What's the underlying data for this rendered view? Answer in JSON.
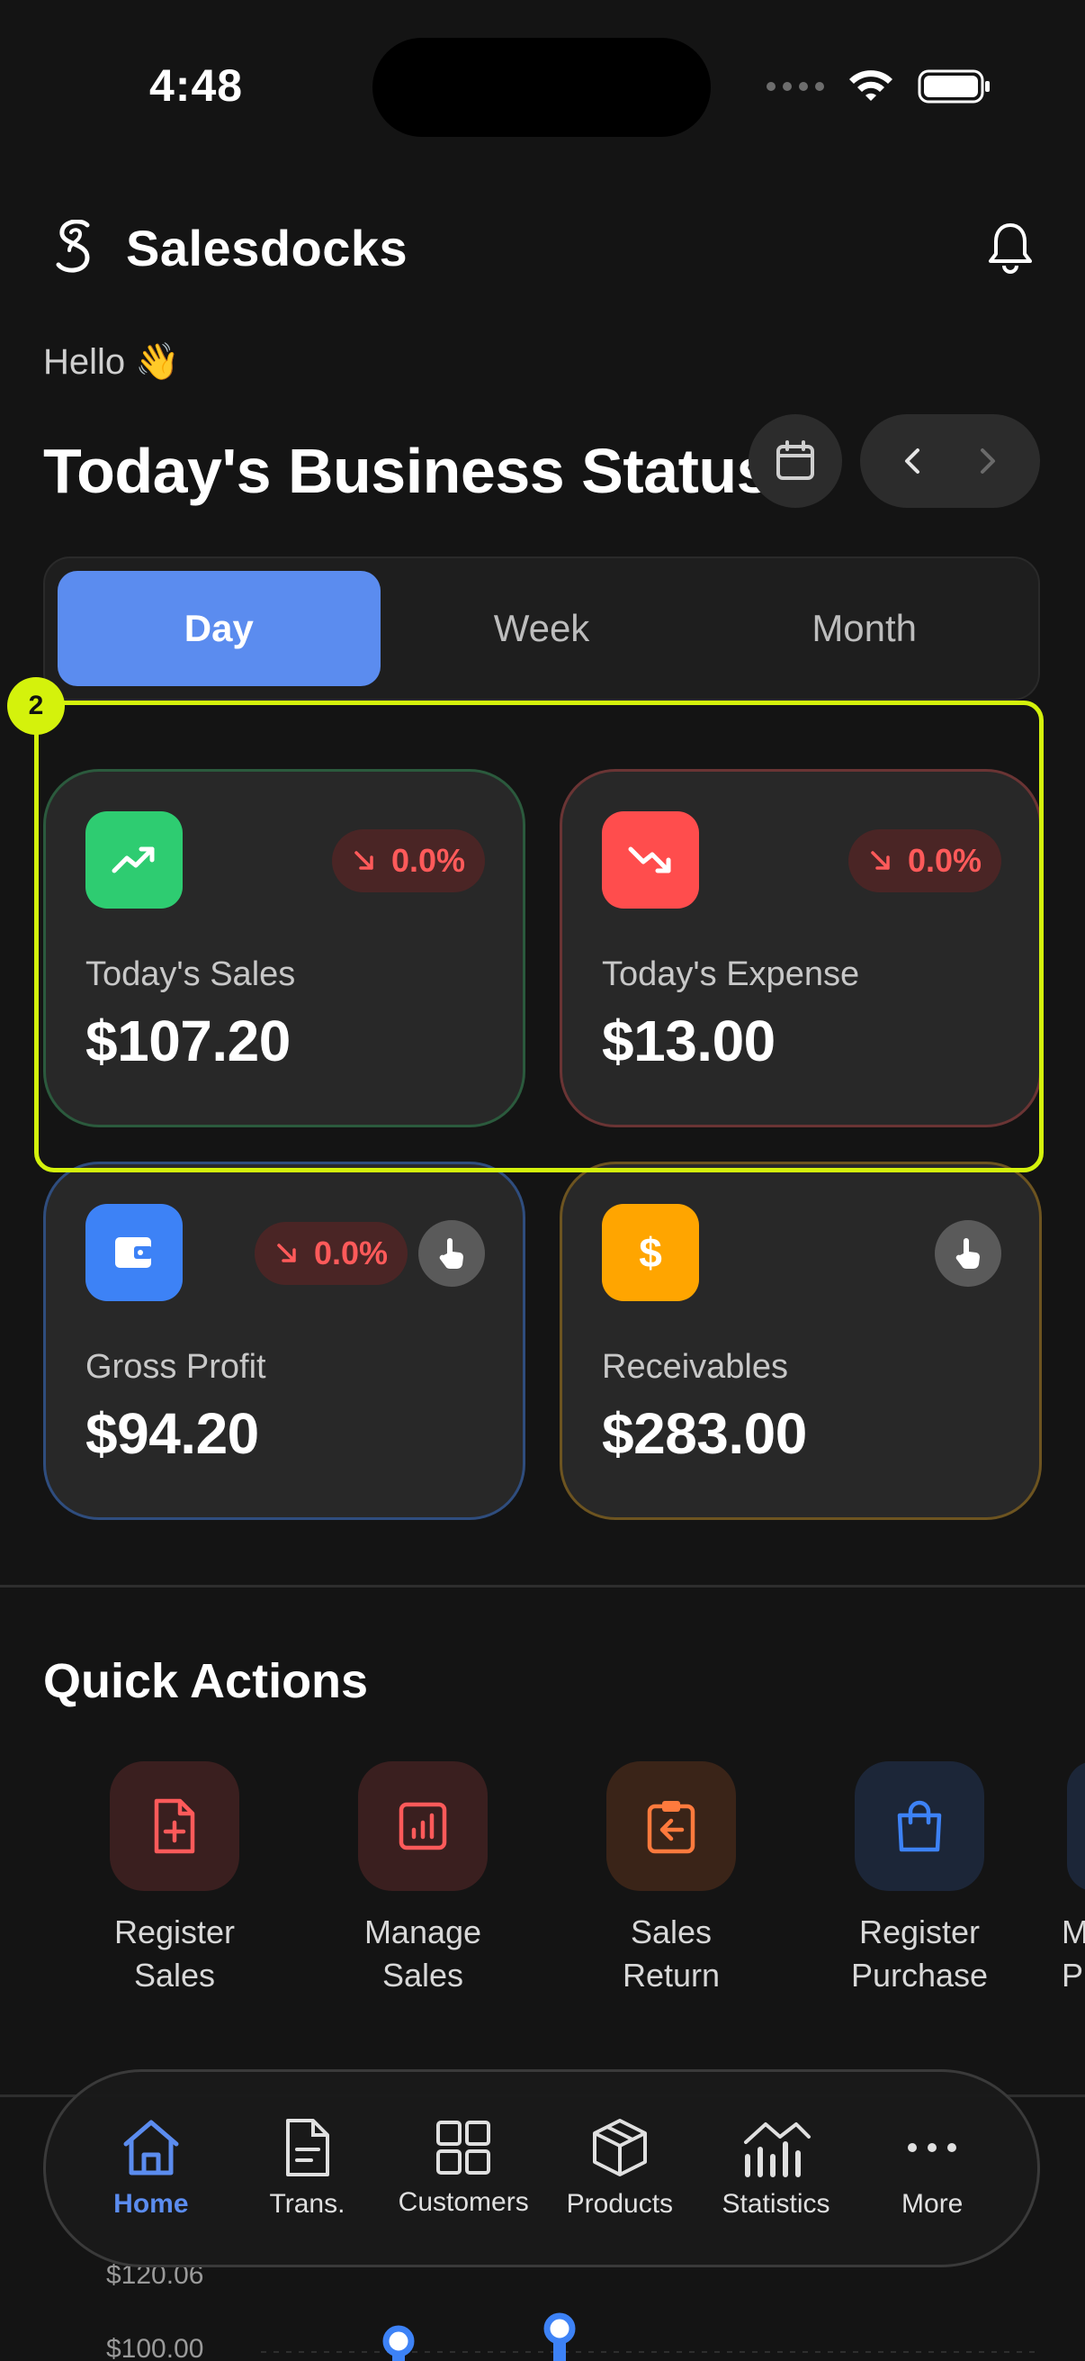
{
  "status_bar": {
    "time": "4:48"
  },
  "header": {
    "brand": "Salesdocks"
  },
  "greeting": "Hello 👋",
  "title": "Today's Business Status",
  "period_tabs": [
    "Day",
    "Week",
    "Month"
  ],
  "active_period": "Day",
  "highlight_number": "2",
  "cards": {
    "sales": {
      "label": "Today's Sales",
      "value": "$107.20",
      "change": "0.0%",
      "color": "#2ecc71"
    },
    "expense": {
      "label": "Today's Expense",
      "value": "$13.00",
      "change": "0.0%",
      "color": "#ff4d4d"
    },
    "profit": {
      "label": "Gross Profit",
      "value": "$94.20",
      "change": "0.0%",
      "color": "#3d82f6"
    },
    "receivables": {
      "label": "Receivables",
      "value": "$283.00",
      "icon_text": "$",
      "color": "#ffa500"
    }
  },
  "quick_actions": {
    "title": "Quick Actions",
    "items": [
      {
        "label": "Register\nSales",
        "icon": "file-plus-icon"
      },
      {
        "label": "Manage\nSales",
        "icon": "report-icon"
      },
      {
        "label": "Sales\nReturn",
        "icon": "clipboard-return-icon"
      },
      {
        "label": "Register\nPurchase",
        "icon": "shopping-bag-icon"
      }
    ],
    "partial_label": "M\nP"
  },
  "chart": {
    "ticks": [
      "$120.06",
      "$100.00"
    ]
  },
  "bottom_nav": [
    {
      "label": "Home",
      "icon": "home-icon"
    },
    {
      "label": "Trans.",
      "icon": "document-icon"
    },
    {
      "label": "Customers",
      "icon": "grid-icon"
    },
    {
      "label": "Products",
      "icon": "cube-icon"
    },
    {
      "label": "Statistics",
      "icon": "chart-icon"
    },
    {
      "label": "More",
      "icon": "more-icon"
    }
  ],
  "colors": {
    "accent": "#5b8cef",
    "negative": "#ff5a5a",
    "highlight": "#d4f20c"
  }
}
